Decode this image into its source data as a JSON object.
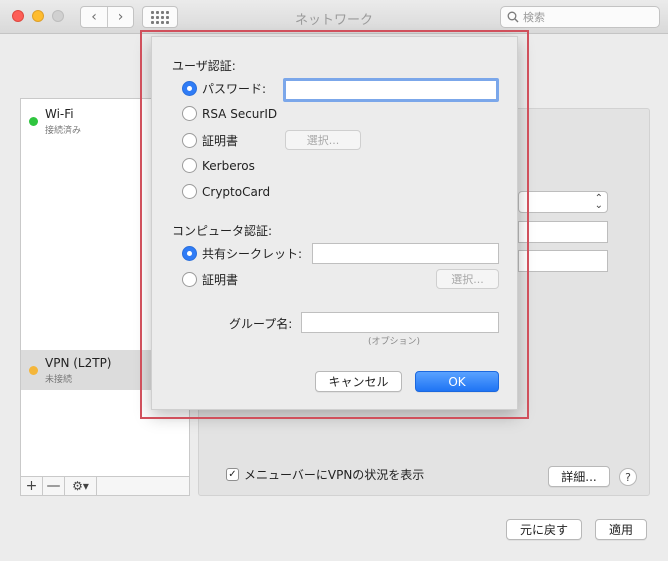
{
  "window": {
    "title": "ネットワーク",
    "search_placeholder": "検索",
    "nav_back": "‹",
    "nav_forward": "›"
  },
  "sidebar": {
    "services": [
      {
        "name": "Wi-Fi",
        "status": "接続済み",
        "status_color": "#2fc53f"
      },
      {
        "name": "VPN (L2TP)",
        "status": "未接続",
        "status_color": "#f4b63a"
      }
    ],
    "add_label": "+",
    "remove_label": "—",
    "gear_label": "⚙︎▾"
  },
  "panel": {
    "show_vpn_status_label": "メニューバーにVPNの状況を表示",
    "show_vpn_status_checked": true,
    "advanced_button": "詳細...",
    "help_button": "?"
  },
  "footer": {
    "revert_button": "元に戻す",
    "apply_button": "適用"
  },
  "sheet": {
    "user_auth_title": "ユーザ認証:",
    "user_auth_options": [
      {
        "label": "パスワード:",
        "selected": true
      },
      {
        "label": "RSA SecurID",
        "selected": false
      },
      {
        "label": "証明書",
        "selected": false
      },
      {
        "label": "Kerberos",
        "selected": false
      },
      {
        "label": "CryptoCard",
        "selected": false
      }
    ],
    "password_value": "",
    "cert_select_button": "選択...",
    "machine_auth_title": "コンピュータ認証:",
    "machine_auth_options": [
      {
        "label": "共有シークレット:",
        "selected": true
      },
      {
        "label": "証明書",
        "selected": false
      }
    ],
    "shared_secret_value": "",
    "machine_cert_select_button": "選択...",
    "group_name_label": "グループ名:",
    "group_name_value": "",
    "group_name_hint": "(オプション)",
    "cancel_button": "キャンセル",
    "ok_button": "OK",
    "accent_color": "#2f7cf6",
    "highlight_color": "#d0505c"
  }
}
